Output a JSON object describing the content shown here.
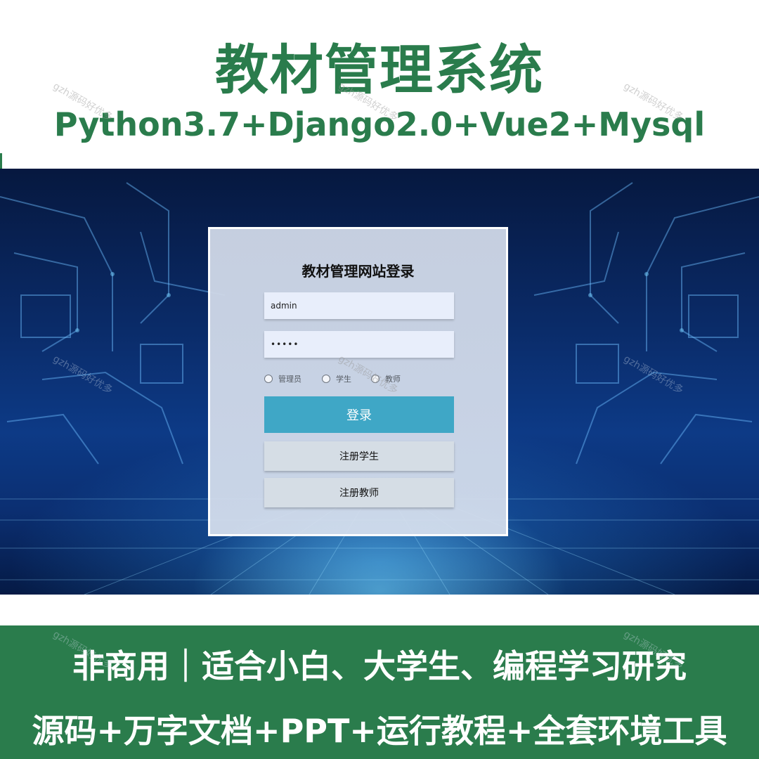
{
  "banner": {
    "title": "教材管理系统",
    "tech_stack": "Python3.7+Django2.0+Vue2+Mysql"
  },
  "login": {
    "title": "教材管理网站登录",
    "username_value": "admin",
    "password_value": "•••••",
    "roles": [
      "管理员",
      "学生",
      "教师"
    ],
    "login_button": "登录",
    "register_student_button": "注册学生",
    "register_teacher_button": "注册教师"
  },
  "footer": {
    "line1": "非商用｜适合小白、大学生、编程学习研究",
    "line2": "源码+万字文档+PPT+运行教程+全套环境工具"
  },
  "watermark": "gzh源码好优多",
  "colors": {
    "brand_green": "#2a7c4c",
    "login_button": "#3fa7c6",
    "register_button": "#d5dde5",
    "background_blue": "#0d3a86"
  }
}
